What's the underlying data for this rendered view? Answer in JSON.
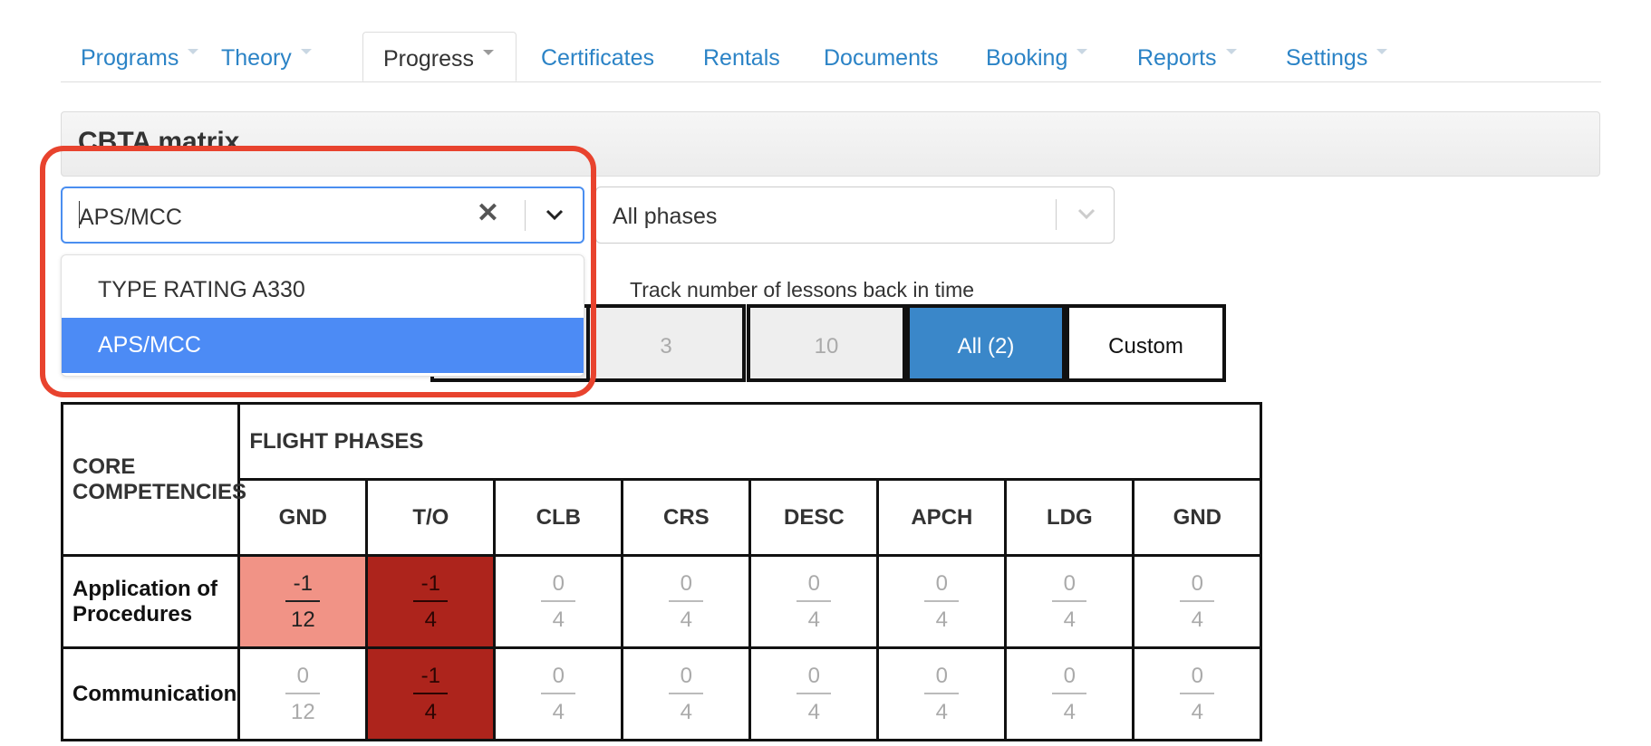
{
  "tabs": [
    {
      "label": "Programs",
      "has_dropdown": true,
      "active": false
    },
    {
      "label": "Theory",
      "has_dropdown": true,
      "active": false
    },
    {
      "label": "Progress",
      "has_dropdown": true,
      "active": true
    },
    {
      "label": "Certificates",
      "has_dropdown": false,
      "active": false
    },
    {
      "label": "Rentals",
      "has_dropdown": false,
      "active": false
    },
    {
      "label": "Documents",
      "has_dropdown": false,
      "active": false
    },
    {
      "label": "Booking",
      "has_dropdown": true,
      "active": false
    },
    {
      "label": "Reports",
      "has_dropdown": true,
      "active": false
    },
    {
      "label": "Settings",
      "has_dropdown": true,
      "active": false
    }
  ],
  "panel": {
    "title": "CBTA matrix"
  },
  "program_select": {
    "value": "APS/MCC",
    "options": [
      {
        "label": "TYPE RATING A330",
        "selected": false
      },
      {
        "label": "APS/MCC",
        "selected": true
      }
    ]
  },
  "phase_select": {
    "value": "All phases"
  },
  "track": {
    "label": "Track number of lessons back in time",
    "buttons": [
      {
        "label": "3",
        "state": "disabled"
      },
      {
        "label": "10",
        "state": "disabled"
      },
      {
        "label": "All (2)",
        "state": "active"
      },
      {
        "label": "Custom",
        "state": "normal"
      }
    ]
  },
  "matrix": {
    "corner_header": "CORE COMPETENCIES",
    "group_header": "FLIGHT PHASES",
    "phases": [
      "GND",
      "T/O",
      "CLB",
      "CRS",
      "DESC",
      "APCH",
      "LDG",
      "GND"
    ],
    "rows": [
      {
        "competency": "Application of Procedures",
        "cells": [
          {
            "num": "-1",
            "den": "12",
            "level": "light"
          },
          {
            "num": "-1",
            "den": "4",
            "level": "dark"
          },
          {
            "num": "0",
            "den": "4",
            "level": "none"
          },
          {
            "num": "0",
            "den": "4",
            "level": "none"
          },
          {
            "num": "0",
            "den": "4",
            "level": "none"
          },
          {
            "num": "0",
            "den": "4",
            "level": "none"
          },
          {
            "num": "0",
            "den": "4",
            "level": "none"
          },
          {
            "num": "0",
            "den": "4",
            "level": "none"
          }
        ]
      },
      {
        "competency": "Communication",
        "cells": [
          {
            "num": "0",
            "den": "12",
            "level": "none"
          },
          {
            "num": "-1",
            "den": "4",
            "level": "dark"
          },
          {
            "num": "0",
            "den": "4",
            "level": "none"
          },
          {
            "num": "0",
            "den": "4",
            "level": "none"
          },
          {
            "num": "0",
            "den": "4",
            "level": "none"
          },
          {
            "num": "0",
            "den": "4",
            "level": "none"
          },
          {
            "num": "0",
            "den": "4",
            "level": "none"
          },
          {
            "num": "0",
            "den": "4",
            "level": "none"
          }
        ]
      }
    ]
  },
  "colors": {
    "link": "#2b83c6",
    "select_focus": "#4a8ef0",
    "option_selected": "#4c8bf5",
    "button_active": "#3a87c9",
    "cell_light": "#f19386",
    "cell_dark": "#ad241c",
    "annotation": "#e8432e"
  }
}
